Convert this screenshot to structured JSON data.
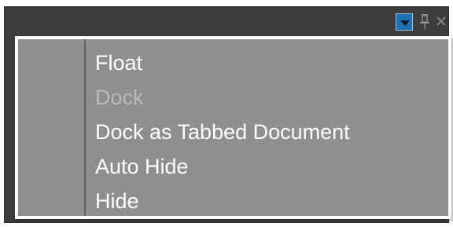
{
  "titlebar": {
    "icons": [
      "chevron-down-icon",
      "pin-icon",
      "close-icon"
    ],
    "colors": {
      "background": "#3d3d3d",
      "dropdown_button": "#1f6fb2"
    }
  },
  "menu": {
    "items": [
      {
        "label": "Float",
        "enabled": true
      },
      {
        "label": "Dock",
        "enabled": false
      },
      {
        "label": "Dock as Tabbed Document",
        "enabled": true
      },
      {
        "label": "Auto Hide",
        "enabled": true
      },
      {
        "label": "Hide",
        "enabled": true
      }
    ],
    "colors": {
      "background": "#8f8f8f",
      "border": "#ffffff",
      "text": "#ffffff",
      "disabled_text": "#b9b9b9"
    }
  }
}
